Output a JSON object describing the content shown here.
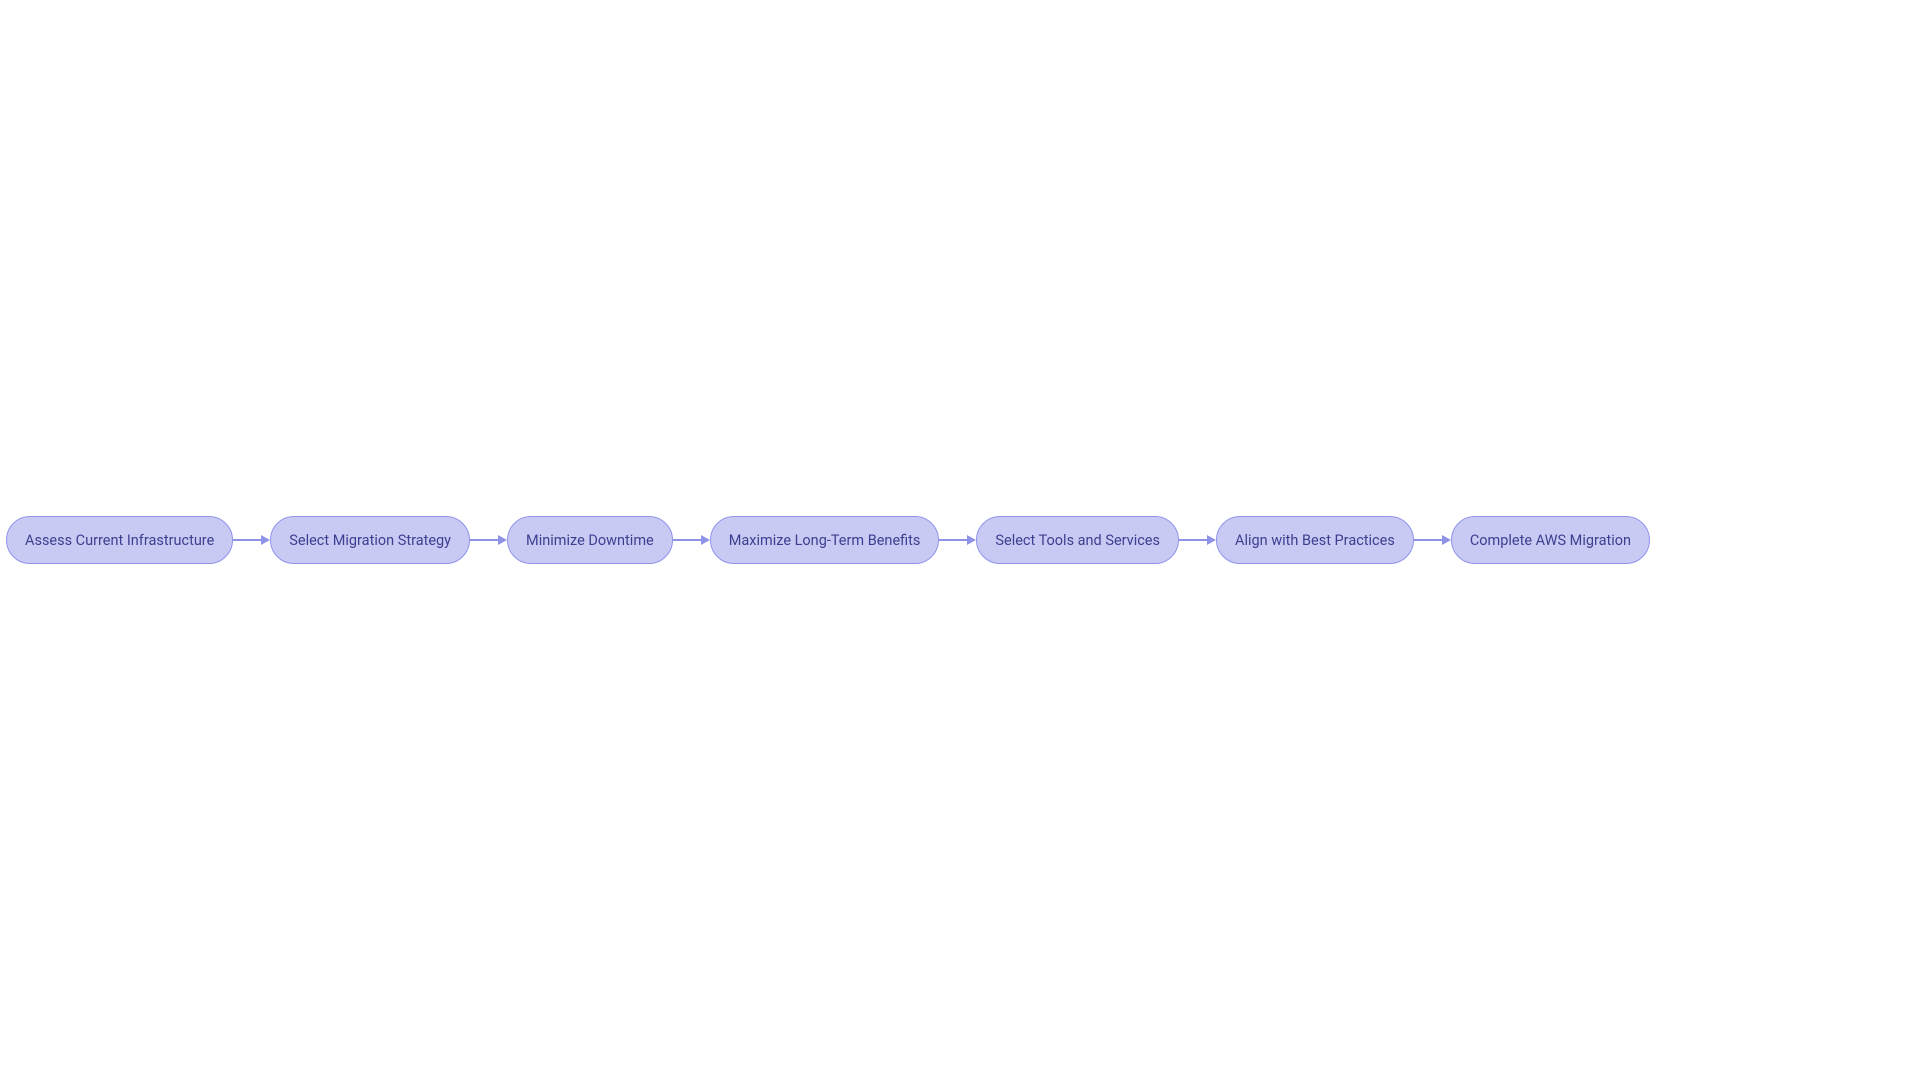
{
  "diagram": {
    "nodes": [
      {
        "label": "Assess Current Infrastructure"
      },
      {
        "label": "Select Migration Strategy"
      },
      {
        "label": "Minimize Downtime"
      },
      {
        "label": "Maximize Long-Term Benefits"
      },
      {
        "label": "Select Tools and Services"
      },
      {
        "label": "Align with Best Practices"
      },
      {
        "label": "Complete AWS Migration"
      }
    ],
    "colors": {
      "node_fill": "#c9caf4",
      "node_border": "#8f93e8",
      "node_text": "#3c3f8f",
      "connector": "#8f93e8",
      "background": "#ffffff"
    }
  }
}
